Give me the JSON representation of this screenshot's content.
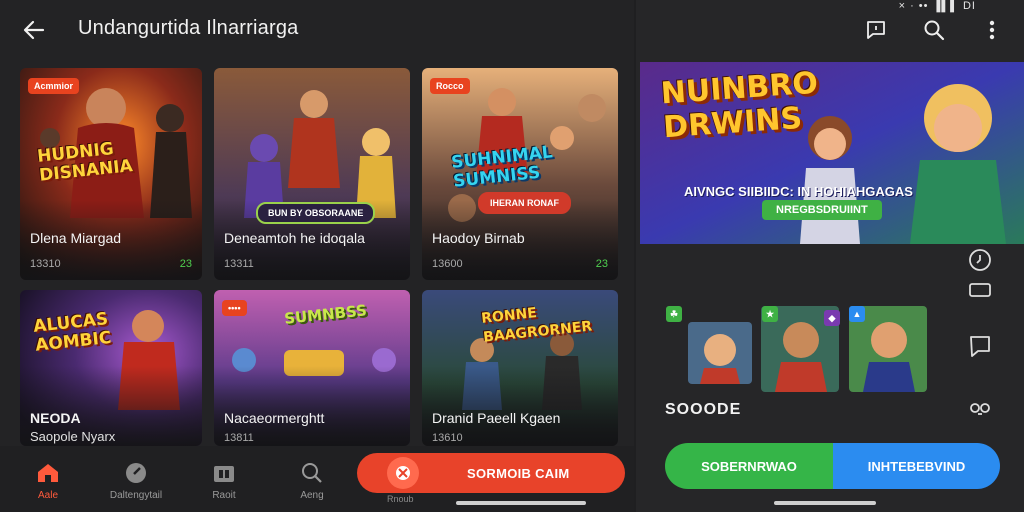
{
  "header": {
    "title": "Undangurtida Ilnarriarga",
    "status_text": "× · •• ▐▌▌ DI"
  },
  "icons": {
    "back": "arrow-left-icon",
    "chat": "chat-icon",
    "search": "search-icon",
    "more": "more-vertical-icon"
  },
  "grid": {
    "cards": [
      {
        "badge": "Acmmior",
        "art_title": "HUDNIG DISNANIA",
        "name": "Dlena Miargad",
        "meta": "13310",
        "meta_right": "23"
      },
      {
        "badge": "",
        "pill": "BUN BY OBSORAANE",
        "name": "Deneamtoh he idoqala",
        "meta": "13311",
        "meta_right": ""
      },
      {
        "badge": "Rocco",
        "art_title": "SUHNIMAL SUMNISS",
        "pill": "IHERAN RONAF",
        "name": "Haodoy Birnab",
        "meta": "13600",
        "meta_right": "23"
      },
      {
        "badge": "",
        "art_title": "ALUCAS AOMBIC",
        "name": "NEODA",
        "name2": "Saopole Nyarx",
        "meta": "",
        "meta_right": ""
      },
      {
        "badge": "••••",
        "art_title": "SUMNBSS",
        "name": "Nacaeormerghtt",
        "meta": "13811",
        "meta_right": ""
      },
      {
        "badge": "",
        "art_title": "RONNE BAAGRORNER",
        "name": "Dranid Paeell Kgaen",
        "meta": "13610",
        "meta_right": ""
      }
    ]
  },
  "bottom_nav": {
    "items": [
      {
        "label": "Aale",
        "icon": "home-icon"
      },
      {
        "label": "Daltengytail",
        "icon": "compass-icon"
      },
      {
        "label": "Raoit",
        "icon": "store-icon"
      },
      {
        "label": "Aeng",
        "icon": "search-icon"
      }
    ],
    "cta": "SORMOIB CAIM",
    "cta_sub": "Rnoub"
  },
  "hero": {
    "title_line1": "NUINBRO",
    "title_line2": "DRWINS",
    "subtitle": "AIVNGC SIIBIIDC: IN HOHIAHGAGAS",
    "pill": "NREGBSDRUIINT"
  },
  "right": {
    "score": "SOOODE",
    "cta_left": "SOBERNRWAO",
    "cta_right": "INHTEBEBVIND"
  },
  "colors": {
    "accent": "#e8432a",
    "green": "#35b548",
    "blue": "#2b8cf0",
    "title_yellow": "#ffc62e"
  }
}
